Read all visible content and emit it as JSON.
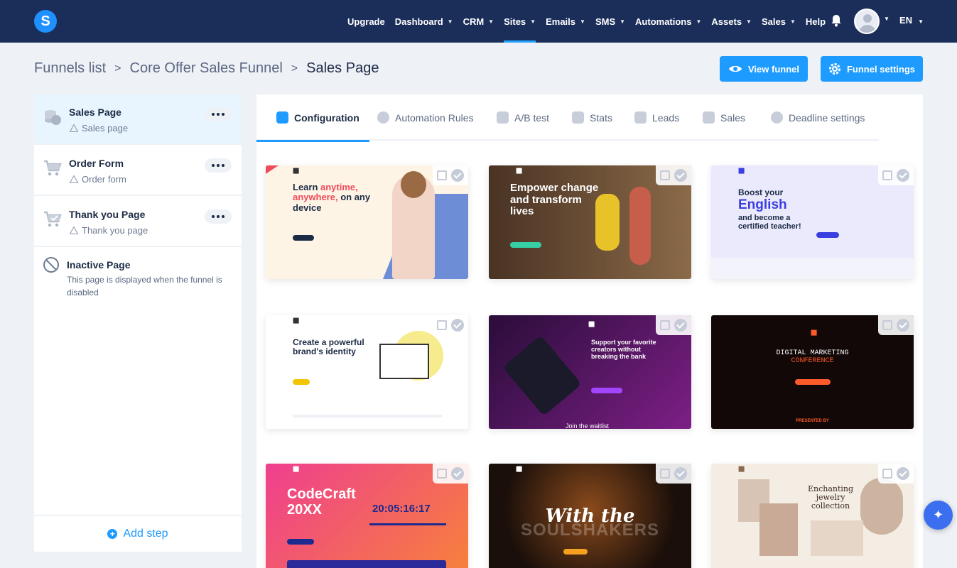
{
  "topnav": {
    "logo_letter": "S",
    "items": [
      {
        "label": "Upgrade",
        "has_menu": false
      },
      {
        "label": "Dashboard",
        "has_menu": true
      },
      {
        "label": "CRM",
        "has_menu": true
      },
      {
        "label": "Sites",
        "has_menu": true,
        "active": true
      },
      {
        "label": "Emails",
        "has_menu": true
      },
      {
        "label": "SMS",
        "has_menu": true
      },
      {
        "label": "Automations",
        "has_menu": true
      },
      {
        "label": "Assets",
        "has_menu": true
      },
      {
        "label": "Sales",
        "has_menu": true
      },
      {
        "label": "Help",
        "has_menu": false
      }
    ],
    "language": "EN",
    "icons": [
      "bell-icon",
      "avatar",
      "chevron-down-icon"
    ]
  },
  "breadcrumb": {
    "items": [
      "Funnels list",
      "Core Offer Sales Funnel",
      "Sales Page"
    ]
  },
  "actions": {
    "view_funnel": "View funnel",
    "funnel_settings": "Funnel settings"
  },
  "sidebar": {
    "steps": [
      {
        "title": "Sales Page",
        "subtitle": "Sales page",
        "icon": "coins-icon",
        "active": true
      },
      {
        "title": "Order Form",
        "subtitle": "Order form",
        "icon": "cart-icon",
        "active": false
      },
      {
        "title": "Thank you Page",
        "subtitle": "Thank you page",
        "icon": "cart-check-icon",
        "active": false
      }
    ],
    "inactive": {
      "title": "Inactive Page",
      "description": "This page is displayed when the funnel is disabled"
    },
    "add_step": "Add step"
  },
  "tabs": [
    {
      "label": "Configuration",
      "icon": "sliders-icon",
      "active": true
    },
    {
      "label": "Automation Rules",
      "icon": "bolt-icon"
    },
    {
      "label": "A/B test",
      "icon": "split-icon"
    },
    {
      "label": "Stats",
      "icon": "bar-chart-icon"
    },
    {
      "label": "Leads",
      "icon": "people-icon"
    },
    {
      "label": "Sales",
      "icon": "dollar-icon"
    },
    {
      "label": "Deadline settings",
      "icon": "clock-icon"
    }
  ],
  "templates": [
    {
      "headline": "Learn anytime, anywhere, on any device",
      "headline_parts": [
        "Learn ",
        "anytime, anywhere,",
        " on any device"
      ],
      "bg": "#fdf4e6",
      "accent": "#f04a5a",
      "theme": "light"
    },
    {
      "headline": "Empower change and transform lives",
      "bg": "#5a3e28",
      "accent": "#36d0a5",
      "theme": "dark"
    },
    {
      "headline": "Boost your English and become a certified teacher!",
      "headline_parts": [
        "Boost your",
        "English",
        "and become a certified teacher!"
      ],
      "bg": "#ebeafd",
      "accent": "#3a3ee0",
      "theme": "light"
    },
    {
      "headline": "Create a powerful brand's identity",
      "bg": "#ffffff",
      "accent": "#f2c500",
      "theme": "light"
    },
    {
      "headline": "Support your favorite creators without breaking the bank",
      "footer": "Join the waitlist",
      "bg": "#4a1150",
      "accent": "#a345ff",
      "theme": "dark"
    },
    {
      "headline": "DIGITAL MARKETING CONFERENCE",
      "headline_parts": [
        "DIGITAL MARKETING",
        "CONFERENCE"
      ],
      "footer": "PRESENTED BY",
      "bg": "#120808",
      "accent": "#ff5a2a",
      "theme": "dark"
    },
    {
      "headline": "CodeCraft 20XX",
      "timer": "20:05:16:17",
      "bg": "#f0487a",
      "accent": "#1d2a8f",
      "theme": "dark"
    },
    {
      "headline": "With the SOULSHAKERS",
      "headline_parts": [
        "With the",
        "SOULSHAKERS"
      ],
      "bg": "#1a0f0a",
      "accent": "#f5a020",
      "theme": "dark"
    },
    {
      "headline": "Enchanting jewelry collection",
      "bg": "#f4ede4",
      "accent": "#8c6a52",
      "theme": "light"
    }
  ],
  "card_icons": [
    "external-link-icon",
    "check-circle-icon"
  ]
}
